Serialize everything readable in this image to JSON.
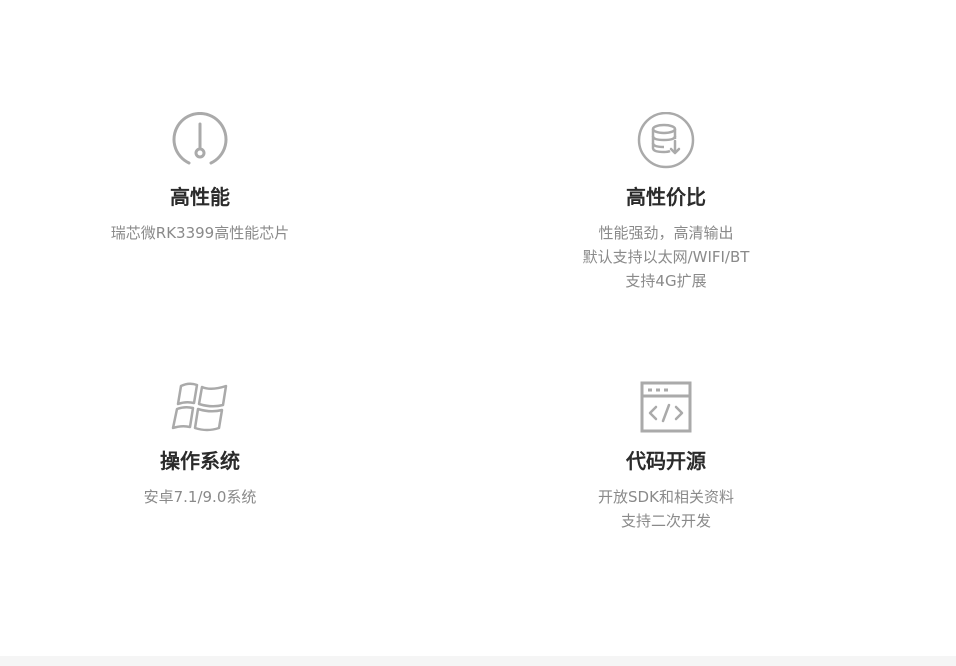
{
  "features": [
    {
      "icon": "gauge-icon",
      "title": "高性能",
      "desc": [
        "瑞芯微RK3399高性能芯片"
      ]
    },
    {
      "icon": "database-download-icon",
      "title": "高性价比",
      "desc": [
        "性能强劲，高清输出",
        "默认支持以太网/WIFI/BT",
        "支持4G扩展"
      ]
    },
    {
      "icon": "windows-icon",
      "title": "操作系统",
      "desc": [
        "安卓7.1/9.0系统"
      ]
    },
    {
      "icon": "code-window-icon",
      "title": "代码开源",
      "desc": [
        "开放SDK和相关资料",
        "支持二次开发"
      ]
    }
  ],
  "colors": {
    "icon_stroke": "#aaaaaa",
    "title": "#2b2b2b",
    "desc": "#8a8a8a"
  }
}
